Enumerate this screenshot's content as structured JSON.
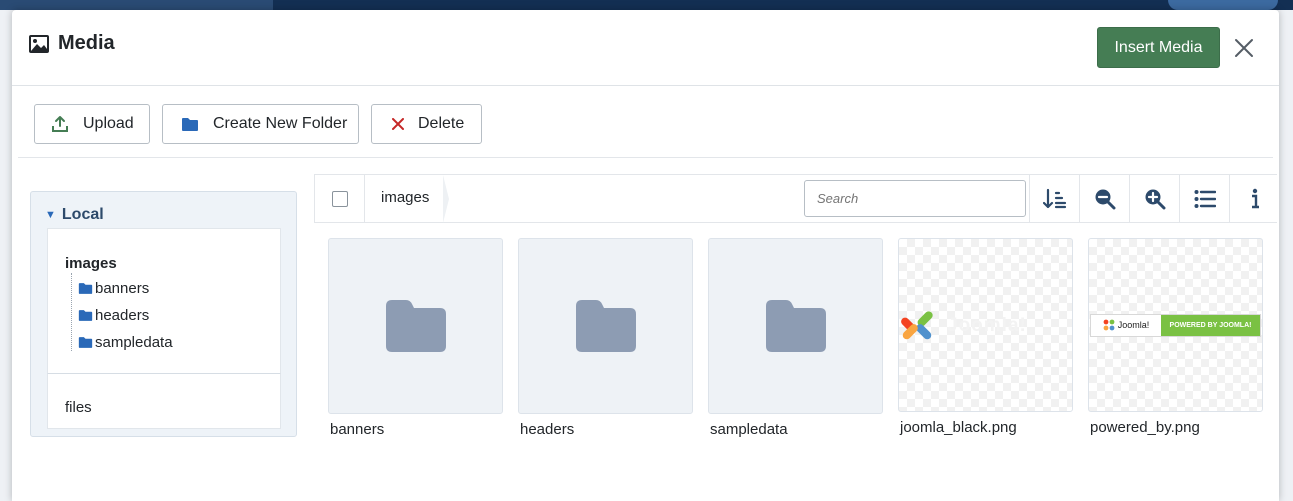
{
  "modal": {
    "title": "Media",
    "insert_label": "Insert Media"
  },
  "toolbar": {
    "upload_label": "Upload",
    "create_folder_label": "Create New Folder",
    "delete_label": "Delete"
  },
  "sidebar": {
    "disk_label": "Local",
    "root": "images",
    "folders": [
      "banners",
      "headers",
      "sampledata"
    ],
    "files_label": "files"
  },
  "browser": {
    "breadcrumb": "images",
    "search_placeholder": "Search",
    "tools": [
      "sort-icon",
      "zoom-out-icon",
      "zoom-in-icon",
      "list-view-icon",
      "info-icon"
    ],
    "items": [
      {
        "name": "banners",
        "type": "folder"
      },
      {
        "name": "headers",
        "type": "folder"
      },
      {
        "name": "sampledata",
        "type": "folder"
      },
      {
        "name": "joomla_black.png",
        "type": "image"
      },
      {
        "name": "powered_by.png",
        "type": "image",
        "badge_left": "Joomla!",
        "badge_right": "POWERED BY JOOMLA!"
      }
    ]
  },
  "colors": {
    "accent_green": "#457d54",
    "folder_blue": "#2a69b8",
    "folder_gray": "#8d9cb3",
    "delete_red": "#c52827"
  }
}
